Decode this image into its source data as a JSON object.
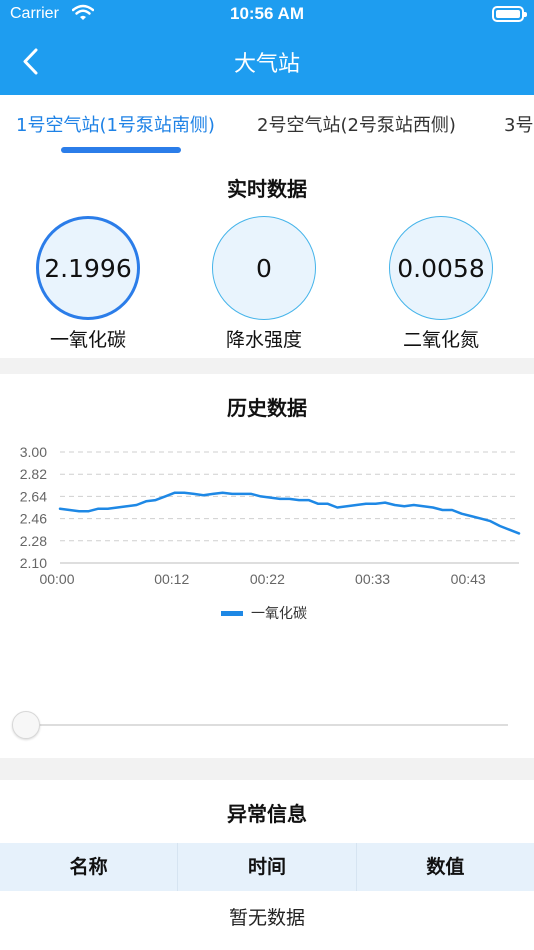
{
  "status_bar": {
    "carrier": "Carrier",
    "time": "10:56 AM"
  },
  "nav": {
    "title": "大气站"
  },
  "tabs": [
    {
      "label": "1号空气站(1号泵站南侧)",
      "active": true
    },
    {
      "label": "2号空气站(2号泵站西侧)",
      "active": false
    },
    {
      "label": "3号",
      "active": false
    }
  ],
  "realtime": {
    "title": "实时数据",
    "gauges": [
      {
        "value": "2.1996",
        "label": "一氧化碳",
        "selected": true
      },
      {
        "value": "0",
        "label": "降水强度",
        "selected": false
      },
      {
        "value": "0.0058",
        "label": "二氧化氮",
        "selected": false
      }
    ]
  },
  "history": {
    "title": "历史数据",
    "legend": "一氧化碳",
    "slider_value": 0
  },
  "chart_data": {
    "type": "line",
    "title": "历史数据",
    "xlabel": "",
    "ylabel": "",
    "ylim": [
      2.1,
      3.0
    ],
    "y_ticks": [
      "3.00",
      "2.82",
      "2.64",
      "2.46",
      "2.28",
      "2.10"
    ],
    "x_ticks": [
      {
        "t": 0,
        "label": "00:00"
      },
      {
        "t": 12,
        "label": "00:12"
      },
      {
        "t": 22,
        "label": "00:22"
      },
      {
        "t": 33,
        "label": "00:33"
      },
      {
        "t": 43,
        "label": "00:43"
      }
    ],
    "grid": true,
    "legend_position": "bottom-center",
    "series": [
      {
        "name": "一氧化碳",
        "color": "#1e88e5",
        "x": [
          0,
          1,
          2,
          3,
          4,
          5,
          6,
          7,
          8,
          9,
          10,
          11,
          12,
          13,
          14,
          15,
          16,
          17,
          18,
          19,
          20,
          21,
          22,
          23,
          24,
          25,
          26,
          27,
          28,
          29,
          30,
          31,
          32,
          33,
          34,
          35,
          36,
          37,
          38,
          39,
          40,
          41,
          42,
          43,
          44,
          45,
          46,
          47,
          48
        ],
        "values": [
          2.54,
          2.53,
          2.52,
          2.52,
          2.54,
          2.54,
          2.55,
          2.56,
          2.57,
          2.6,
          2.61,
          2.64,
          2.67,
          2.67,
          2.66,
          2.65,
          2.66,
          2.67,
          2.66,
          2.66,
          2.66,
          2.64,
          2.63,
          2.62,
          2.62,
          2.61,
          2.61,
          2.58,
          2.58,
          2.55,
          2.56,
          2.57,
          2.58,
          2.58,
          2.59,
          2.57,
          2.56,
          2.57,
          2.56,
          2.55,
          2.53,
          2.53,
          2.5,
          2.48,
          2.46,
          2.44,
          2.4,
          2.37,
          2.34
        ]
      }
    ]
  },
  "abnormal": {
    "title": "异常信息",
    "columns": [
      "名称",
      "时间",
      "数值"
    ],
    "empty_text": "暂无数据"
  }
}
